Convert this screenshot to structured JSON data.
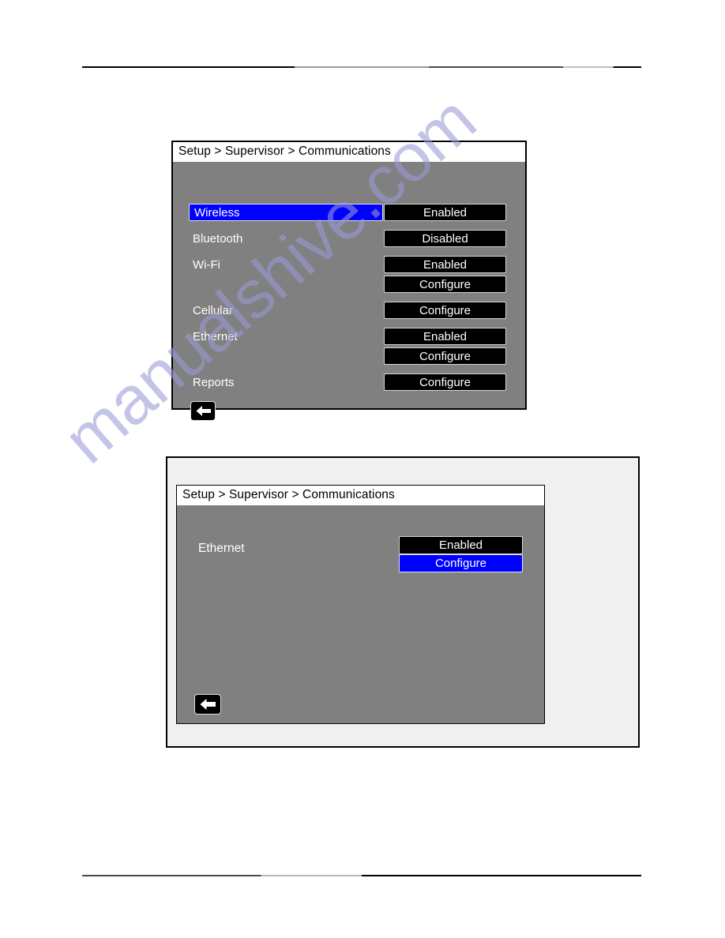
{
  "page": {
    "watermark": "manualshive.com"
  },
  "figure1": {
    "title": "Setup > Supervisor > Communications",
    "highlighted_row": "Wireless",
    "rows": [
      {
        "label": "Wireless",
        "buttons": [
          "Enabled"
        ],
        "highlighted": true
      },
      {
        "label": "Bluetooth",
        "buttons": [
          "Disabled"
        ],
        "highlighted": false
      },
      {
        "label": "Wi-Fi",
        "buttons": [
          "Enabled",
          "Configure"
        ],
        "highlighted": false
      },
      {
        "label": "Cellular",
        "buttons": [
          "Configure"
        ],
        "highlighted": false
      },
      {
        "label": "Ethernet",
        "buttons": [
          "Enabled",
          "Configure"
        ],
        "highlighted": false
      },
      {
        "label": "Reports",
        "buttons": [
          "Configure"
        ],
        "highlighted": false
      }
    ],
    "labels": {
      "wireless": "Wireless",
      "bluetooth": "Bluetooth",
      "wifi": "Wi-Fi",
      "cellular": "Cellular",
      "ethernet": "Ethernet",
      "reports": "Reports"
    },
    "buttons": {
      "wireless_state": "Enabled",
      "bluetooth_state": "Disabled",
      "wifi_state": "Enabled",
      "wifi_configure": "Configure",
      "cellular_configure": "Configure",
      "ethernet_state": "Enabled",
      "ethernet_configure": "Configure",
      "reports_configure": "Configure"
    },
    "back_icon": "back-arrow-icon"
  },
  "figure2": {
    "title": "Setup > Supervisor > Communications",
    "rows": [
      {
        "label": "Ethernet",
        "buttons": [
          "Enabled",
          "Configure"
        ],
        "selected": "Configure"
      }
    ],
    "labels": {
      "ethernet": "Ethernet"
    },
    "buttons": {
      "ethernet_state": "Enabled",
      "ethernet_configure": "Configure"
    },
    "back_icon": "back-arrow-icon"
  },
  "colors": {
    "screen_background": "#808080",
    "title_background": "#ffffff",
    "button_background": "#000000",
    "highlight": "#0000ff",
    "button_text": "#ffffff",
    "frame_background": "#f0f0f0",
    "watermark": "#9a9ad8"
  }
}
